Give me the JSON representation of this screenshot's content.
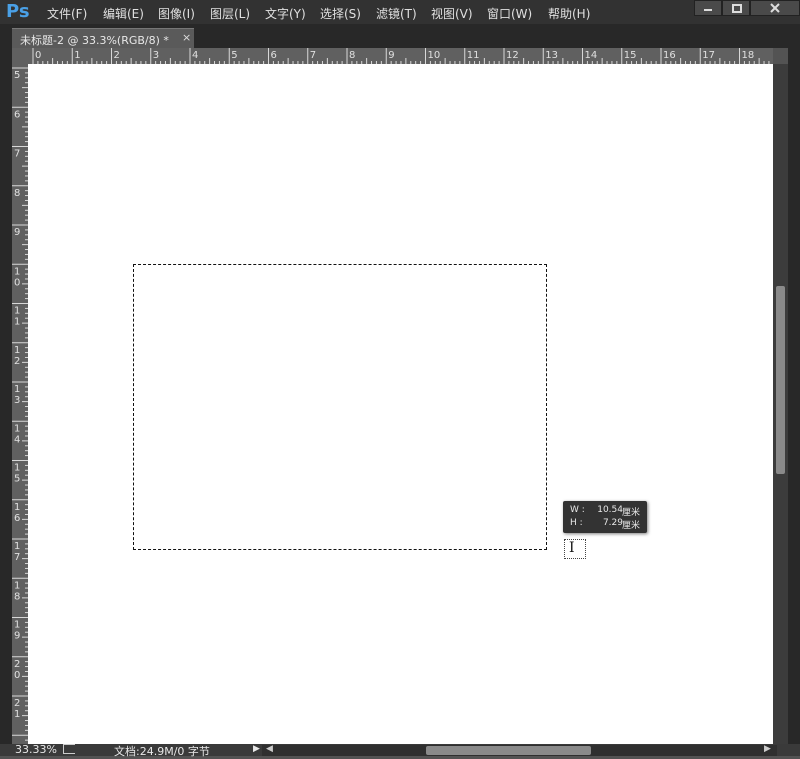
{
  "app": {
    "logo": "Ps"
  },
  "menu": [
    {
      "id": "file",
      "label": "文件(F)"
    },
    {
      "id": "edit",
      "label": "编辑(E)"
    },
    {
      "id": "image",
      "label": "图像(I)"
    },
    {
      "id": "layer",
      "label": "图层(L)"
    },
    {
      "id": "type",
      "label": "文字(Y)"
    },
    {
      "id": "select",
      "label": "选择(S)"
    },
    {
      "id": "filter",
      "label": "滤镜(T)"
    },
    {
      "id": "view",
      "label": "视图(V)"
    },
    {
      "id": "window",
      "label": "窗口(W)"
    },
    {
      "id": "help",
      "label": "帮助(H)"
    }
  ],
  "document_tab": {
    "title": "未标题-2 @ 33.3%(RGB/8) *",
    "close": "×"
  },
  "rulers": {
    "horizontal": [
      "0",
      "1",
      "2",
      "3",
      "4",
      "5",
      "6",
      "7",
      "8",
      "9",
      "10",
      "11",
      "12",
      "13",
      "14",
      "15",
      "16",
      "17",
      "18"
    ],
    "vertical": [
      "5",
      "6",
      "7",
      "8",
      "9",
      "10",
      "11",
      "12",
      "13",
      "14",
      "15",
      "16",
      "17",
      "18",
      "19",
      "20",
      "21"
    ]
  },
  "tooltip": {
    "w_label": "W :",
    "w_value": "10.54",
    "w_unit": "厘米",
    "h_label": "H :",
    "h_value": "7.29",
    "h_unit": "厘米"
  },
  "status": {
    "zoom": "33.33%",
    "doc_info": "文档:24.9M/0 字节"
  }
}
